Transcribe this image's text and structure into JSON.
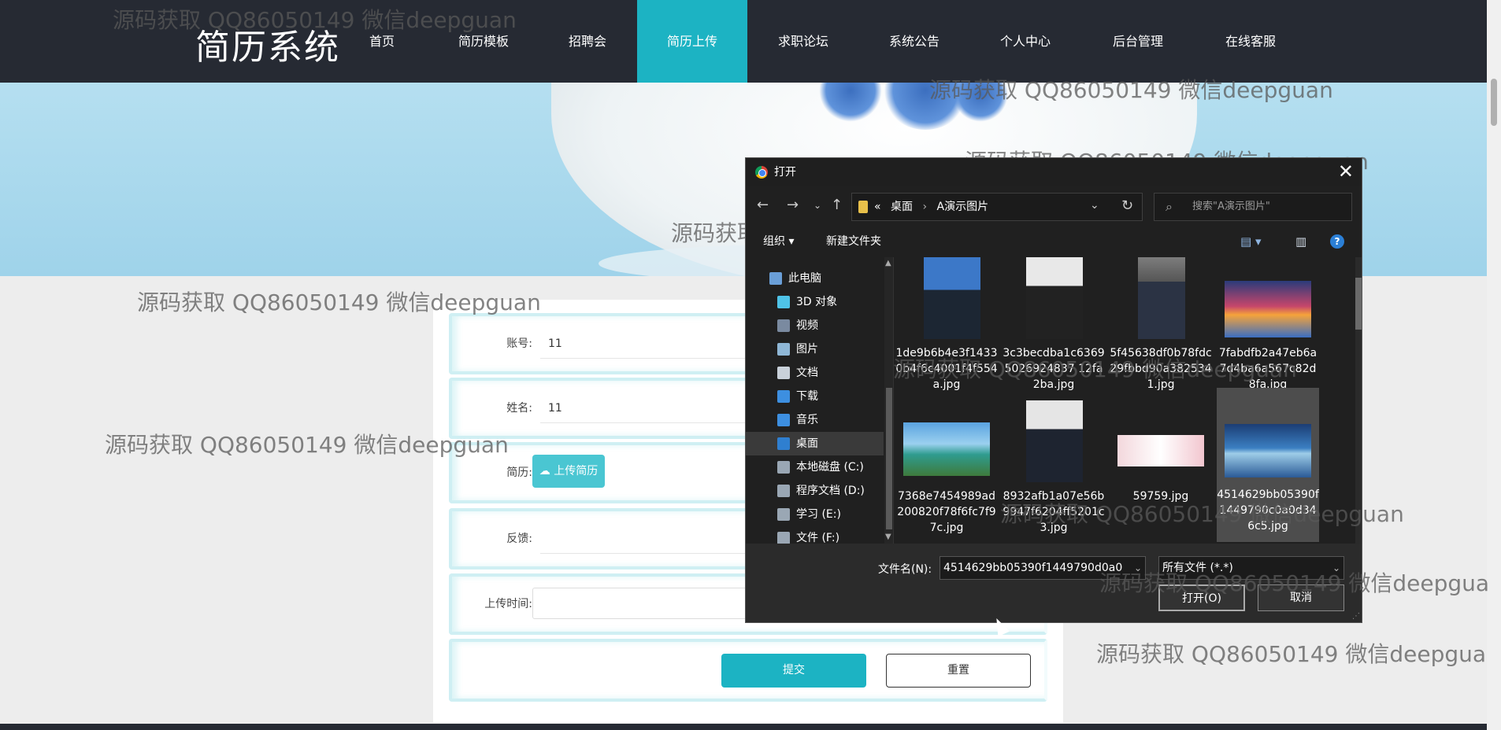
{
  "brand": "简历系统",
  "nav": [
    "首页",
    "简历模板",
    "招聘会",
    "简历上传",
    "求职论坛",
    "系统公告",
    "个人中心",
    "后台管理",
    "在线客服"
  ],
  "nav_active": "简历上传",
  "form": {
    "account_label": "账号:",
    "account_value": "11",
    "name_label": "姓名:",
    "name_value": "11",
    "resume_label": "简历:",
    "upload_button": "上传简历",
    "feedback_label": "反馈:",
    "upload_time_label": "上传时间:",
    "submit": "提交",
    "reset": "重置"
  },
  "watermark": "源码获取 QQ86050149 微信deepguan",
  "watermark_cut": "源码获取 QQ86050149 微信deepgua",
  "dialog": {
    "title": "打开",
    "address": {
      "prefix": "«",
      "crumbs": [
        "桌面",
        "A演示图片"
      ]
    },
    "search_placeholder": "搜索\"A演示图片\"",
    "toolbar": {
      "organize": "组织 ▾",
      "new_folder": "新建文件夹"
    },
    "tree": [
      {
        "label": "此电脑",
        "icon": "pc-icon"
      },
      {
        "label": "3D 对象",
        "icon": "3d-objects-icon"
      },
      {
        "label": "视频",
        "icon": "video-icon"
      },
      {
        "label": "图片",
        "icon": "pictures-icon"
      },
      {
        "label": "文档",
        "icon": "documents-icon"
      },
      {
        "label": "下载",
        "icon": "download-icon"
      },
      {
        "label": "音乐",
        "icon": "music-icon"
      },
      {
        "label": "桌面",
        "icon": "desktop-icon",
        "selected": true
      },
      {
        "label": "本地磁盘 (C:)",
        "icon": "drive-icon"
      },
      {
        "label": "程序文档 (D:)",
        "icon": "drive-icon"
      },
      {
        "label": "学习 (E:)",
        "icon": "drive-icon"
      },
      {
        "label": "文件 (F:)",
        "icon": "drive-icon"
      }
    ],
    "files": [
      {
        "name": "1de9b6b4e3f14330b4f6c4001f4f554a.jpg",
        "kind": "portrait-blue"
      },
      {
        "name": "3c3becdba1c63695026924837 12fa2ba.jpg",
        "kind": "portrait-suit"
      },
      {
        "name": "5f45638df0b78fdc29fbbd90a3825341.jpg",
        "kind": "portrait-sitting"
      },
      {
        "name": "7fabdfb2a47eb6a7d4ba6a567c82d8fa.jpg",
        "kind": "sunset"
      },
      {
        "name": "7368e7454989ad200820f78f6fc7f97c.jpg",
        "kind": "beach"
      },
      {
        "name": "8932afb1a07e56b9947f6204ff5201c3.jpg",
        "kind": "portrait-suit"
      },
      {
        "name": "59759.jpg",
        "kind": "wedding"
      },
      {
        "name": "4514629bb05390f1449790c0a0d346c5.jpg",
        "kind": "lake",
        "selected": true
      }
    ],
    "filename_label": "文件名(N):",
    "filename_value": "4514629bb05390f1449790d0a0",
    "filter_value": "所有文件 (*.*)",
    "open_button": "打开(O)",
    "cancel_button": "取消"
  }
}
